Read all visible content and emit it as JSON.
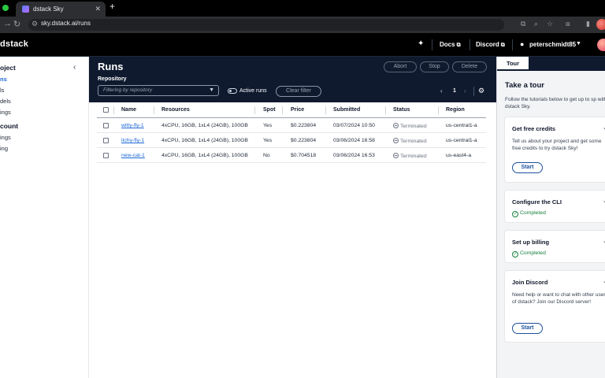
{
  "browser": {
    "tab_title": "dstack Sky",
    "tab_close": "✕",
    "new_tab": "+",
    "url": "sky.dstack.ai/runs"
  },
  "app": {
    "brand": "dstack",
    "docs_label": "Docs",
    "discord_label": "Discord",
    "username": "peterschmidt85"
  },
  "sidebar": {
    "project_heading": "oject",
    "project_items": [
      {
        "label": "ns",
        "active": true
      },
      {
        "label": "ls",
        "active": false
      },
      {
        "label": "dels",
        "active": false
      },
      {
        "label": "ings",
        "active": false
      }
    ],
    "account_heading": "count",
    "account_items": [
      {
        "label": "ings"
      },
      {
        "label": "ing"
      }
    ]
  },
  "runs": {
    "title": "Runs",
    "abort_label": "Abort",
    "stop_label": "Stop",
    "delete_label": "Delete",
    "repository_label": "Repository",
    "repository_placeholder": "Filtering by repository",
    "active_runs_label": "Active runs",
    "clear_filter_label": "Clear filter",
    "page": "1"
  },
  "table": {
    "columns": [
      "Name",
      "Resources",
      "Spot",
      "Price",
      "Submitted",
      "Status",
      "Region"
    ],
    "rows": [
      {
        "name": "witty-fly-1",
        "resources": "4xCPU, 16GB, 1xL4 (24GB), 100GB",
        "spot": "Yes",
        "price": "$0.223804",
        "submitted": "03/07/2024 10:50",
        "status": "Terminated",
        "region": "us-central1-a"
      },
      {
        "name": "itchy-fly-1",
        "resources": "4xCPU, 16GB, 1xL4 (24GB), 100GB",
        "spot": "Yes",
        "price": "$0.223804",
        "submitted": "03/06/2024 16:58",
        "status": "Terminated",
        "region": "us-central1-a"
      },
      {
        "name": "new-cat-1",
        "resources": "4xCPU, 16GB, 1xL4 (24GB), 100GB",
        "spot": "No",
        "price": "$0.704518",
        "submitted": "03/06/2024 16:53",
        "status": "Terminated",
        "region": "us-east4-a"
      }
    ]
  },
  "tour": {
    "tab_label": "Tour",
    "title": "Take a tour",
    "description": "Follow the tutorials below to get up to sp with dstack Sky.",
    "cards": [
      {
        "title": "Get free credits",
        "text": "Tell us about your project and get some free credits to try dstack Sky!",
        "button": "Start"
      },
      {
        "title": "Configure the CLI",
        "status": "Completed"
      },
      {
        "title": "Set up billing",
        "status": "Completed"
      },
      {
        "title": "Join Discord",
        "text": "Need help or want to chat with other users of dstack? Join our Discord server!",
        "button": "Start"
      }
    ]
  },
  "colors": {
    "accent": "#1a66d6",
    "header_bg": "#0f1a2f",
    "success": "#15803d"
  }
}
